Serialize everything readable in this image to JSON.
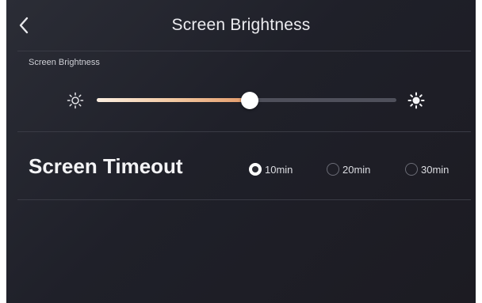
{
  "header": {
    "title": "Screen Brightness",
    "back_icon": "chevron-left-icon"
  },
  "brightness": {
    "label": "Screen Brightness",
    "level": 0.51,
    "min_icon": "sun-outline-icon",
    "max_icon": "sun-filled-icon",
    "fill_colors": [
      "#fbeee0",
      "#e39a6a"
    ]
  },
  "timeout": {
    "title": "Screen Timeout",
    "options": [
      {
        "label": "10min",
        "selected": true
      },
      {
        "label": "20min",
        "selected": false
      },
      {
        "label": "30min",
        "selected": false
      }
    ]
  }
}
